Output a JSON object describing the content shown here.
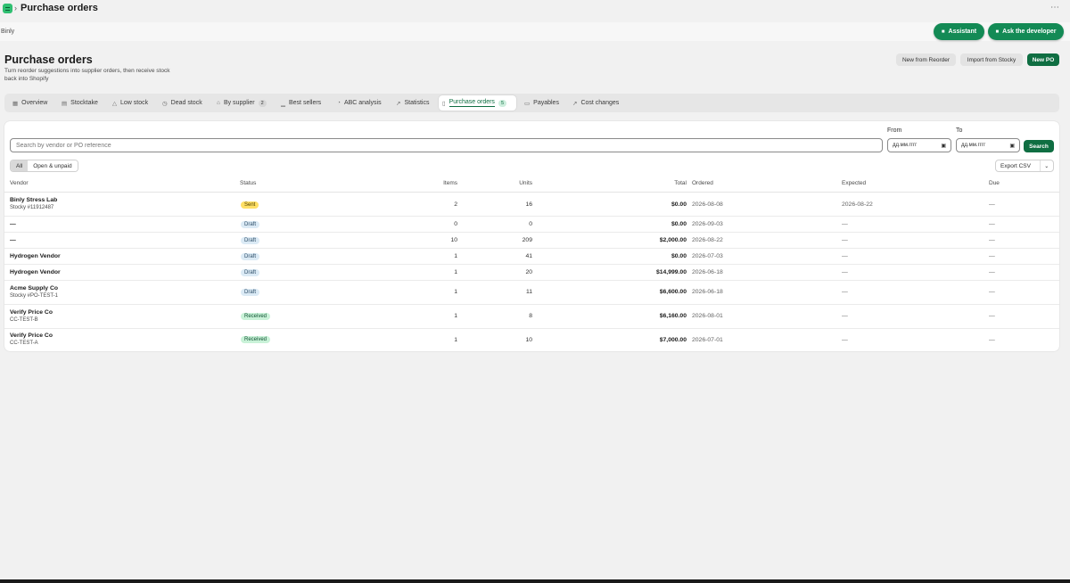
{
  "topbar": {
    "title": "Purchase orders",
    "separator": "›",
    "more": "⋯"
  },
  "shop": {
    "name": "Binly"
  },
  "actions": {
    "assistant": "Assistant",
    "ask_developer": "Ask the developer"
  },
  "header": {
    "title": "Purchase orders",
    "subtitle": "Turn reorder suggestions into supplier orders, then receive stock back into Shopify",
    "new_from_reorder": "New from Reorder",
    "import_from_stocky": "Import from Stocky",
    "new_po": "New PO"
  },
  "tabs": [
    {
      "label": "Overview",
      "icon": "grid-icon"
    },
    {
      "label": "Stocktake",
      "icon": "clipboard-icon"
    },
    {
      "label": "Low stock",
      "icon": "warning-icon"
    },
    {
      "label": "Dead stock",
      "icon": "clock-icon"
    },
    {
      "label": "By supplier",
      "icon": "store-icon",
      "count": "2"
    },
    {
      "label": "Best sellers",
      "icon": "chart-icon"
    },
    {
      "label": "ABC analysis",
      "icon": "pie-icon"
    },
    {
      "label": "Statistics",
      "icon": "stats-icon"
    },
    {
      "label": "Purchase orders",
      "icon": "document-icon",
      "count": "5",
      "active": true
    },
    {
      "label": "Payables",
      "icon": "wallet-icon"
    },
    {
      "label": "Cost changes",
      "icon": "trend-icon"
    }
  ],
  "filters": {
    "search_placeholder": "Search by vendor or PO reference",
    "from_label": "From",
    "to_label": "To",
    "date_placeholder": "дд.мм.гггг",
    "search_button": "Search",
    "segments": [
      "All",
      "Open & unpaid"
    ],
    "export": "Export CSV"
  },
  "columns": {
    "vendor": "Vendor",
    "status": "Status",
    "items": "Items",
    "units": "Units",
    "total": "Total",
    "ordered": "Ordered",
    "expected": "Expected",
    "due": "Due"
  },
  "rows": [
    {
      "vendor": "Binly Stress Lab",
      "ref": "Stocky #11912487",
      "status": "Sent",
      "items": "2",
      "units": "16",
      "total": "$0.00",
      "ordered": "2026-08-08",
      "expected": "2026-08-22",
      "due": "—"
    },
    {
      "vendor": "—",
      "ref": "",
      "status": "Draft",
      "items": "0",
      "units": "0",
      "total": "$0.00",
      "ordered": "2026-09-03",
      "expected": "—",
      "due": "—"
    },
    {
      "vendor": "—",
      "ref": "",
      "status": "Draft",
      "items": "10",
      "units": "209",
      "total": "$2,000.00",
      "ordered": "2026-08-22",
      "expected": "—",
      "due": "—"
    },
    {
      "vendor": "Hydrogen Vendor",
      "ref": "",
      "status": "Draft",
      "items": "1",
      "units": "41",
      "total": "$0.00",
      "ordered": "2026-07-03",
      "expected": "—",
      "due": "—"
    },
    {
      "vendor": "Hydrogen Vendor",
      "ref": "",
      "status": "Draft",
      "items": "1",
      "units": "20",
      "total": "$14,999.00",
      "ordered": "2026-06-18",
      "expected": "—",
      "due": "—"
    },
    {
      "vendor": "Acme Supply Co",
      "ref": "Stocky #PO-TEST-1",
      "status": "Draft",
      "items": "1",
      "units": "11",
      "total": "$6,600.00",
      "ordered": "2026-06-18",
      "expected": "—",
      "due": "—"
    },
    {
      "vendor": "Verify Price Co",
      "ref": "CC-TEST-B",
      "status": "Received",
      "items": "1",
      "units": "8",
      "total": "$6,160.00",
      "ordered": "2026-08-01",
      "expected": "—",
      "due": "—"
    },
    {
      "vendor": "Verify Price Co",
      "ref": "CC-TEST-A",
      "status": "Received",
      "items": "1",
      "units": "10",
      "total": "$7,000.00",
      "ordered": "2026-07-01",
      "expected": "—",
      "due": "—"
    }
  ],
  "colors": {
    "accent": "#0f6e42",
    "pill": "#138a55",
    "sent": "#ffe066",
    "draft": "#dbeaf5",
    "received": "#c9f2d8"
  }
}
